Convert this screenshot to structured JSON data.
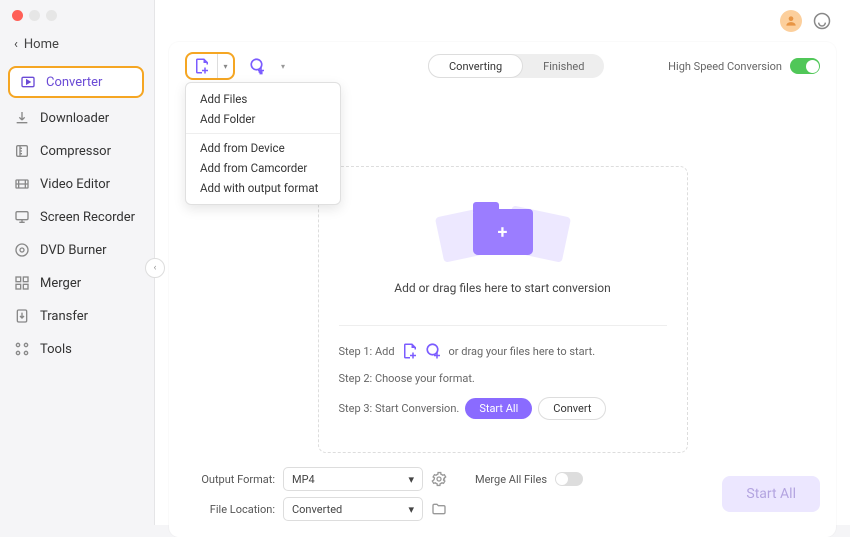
{
  "home": "Home",
  "nav": {
    "converter": "Converter",
    "downloader": "Downloader",
    "compressor": "Compressor",
    "video_editor": "Video Editor",
    "screen_recorder": "Screen Recorder",
    "dvd_burner": "DVD Burner",
    "merger": "Merger",
    "transfer": "Transfer",
    "tools": "Tools"
  },
  "tabs": {
    "converting": "Converting",
    "finished": "Finished"
  },
  "hsc_label": "High Speed Conversion",
  "dropdown": {
    "add_files": "Add Files",
    "add_folder": "Add Folder",
    "add_from_device": "Add from Device",
    "add_from_camcorder": "Add from Camcorder",
    "add_with_output_format": "Add with output format"
  },
  "drop_text": "Add or drag files here to start conversion",
  "steps": {
    "s1a": "Step 1: Add",
    "s1b": "or drag your files here to start.",
    "s2": "Step 2: Choose your format.",
    "s3": "Step 3: Start Conversion.",
    "start_all": "Start  All",
    "convert": "Convert"
  },
  "bottom": {
    "output_format_label": "Output Format:",
    "output_format_value": "MP4",
    "file_location_label": "File Location:",
    "file_location_value": "Converted",
    "merge_label": "Merge All Files",
    "start_all": "Start All"
  }
}
